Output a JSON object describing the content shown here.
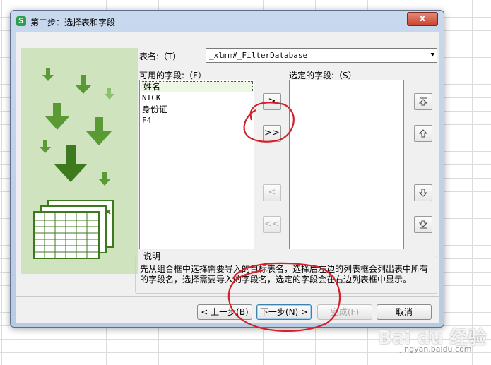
{
  "window": {
    "title": "第二步：选择表和字段",
    "app_icon": "S",
    "close_label": "x"
  },
  "table": {
    "label": "表名:（T）",
    "selected": "_xlmm#_FilterDatabase"
  },
  "available": {
    "label": "可用的字段:（F）",
    "items": [
      "姓名",
      "NICK",
      "身份证",
      "F4"
    ],
    "selected_index": 0
  },
  "selected_fields": {
    "label": "选定的字段:（S）",
    "items": []
  },
  "transfer_buttons": {
    "add_one": ">",
    "add_all": ">>",
    "remove_one": "<",
    "remove_all": "<<"
  },
  "description": {
    "title": "说明",
    "text": "先从组合框中选择需要导入的目标表名，选择后左边的列表框会列出表中所有的字段名，选择需要导入的字段名，选定的字段会在右边列表框中显示。"
  },
  "footer": {
    "prev": "< 上一步(B)",
    "next": "下一步(N) >",
    "finish": "完成(F)",
    "cancel": "取消"
  },
  "watermark": {
    "brand": "Bai du 经验",
    "url": "jingyan.baidu.com"
  },
  "colors": {
    "accent_green": "#4a8b2c",
    "panel_green": "#cfe3bf",
    "annotation_red": "#d3202a"
  }
}
